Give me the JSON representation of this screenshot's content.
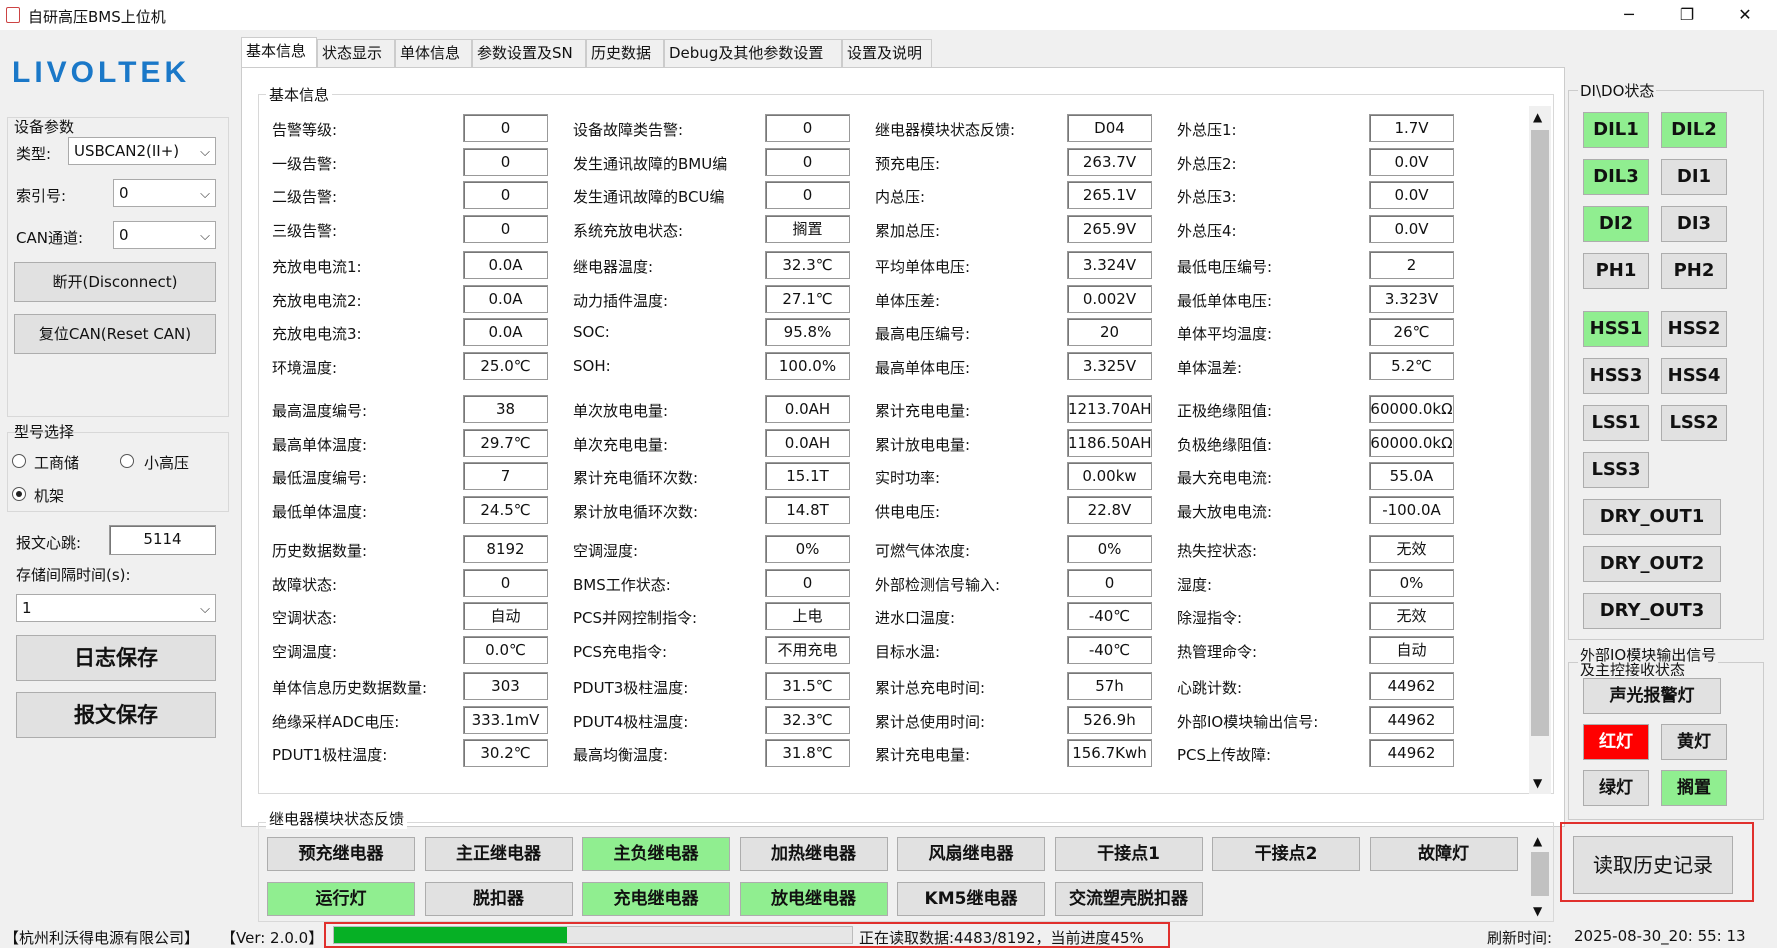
{
  "window": {
    "title": "自研高压BMS上位机",
    "min": "─",
    "max": "❐",
    "close": "✕"
  },
  "logo": "LIVOLTEK",
  "device": {
    "group_title": "设备参数",
    "type_label": "类型:",
    "type_value": "USBCAN2(II+)",
    "index_label": "索引号:",
    "index_value": "0",
    "channel_label": "CAN通道:",
    "channel_value": "0",
    "disconnect": "断开(Disconnect)",
    "reset": "复位CAN(Reset CAN)"
  },
  "model": {
    "group_title": "型号选择",
    "opt1": "工商储",
    "opt2": "小高压",
    "opt3": "机架",
    "selected": "机架"
  },
  "heartbeat_label": "报文心跳:",
  "heartbeat_value": "5114",
  "interval_label": "存储间隔时间(s):",
  "interval_value": "1",
  "log_save": "日志保存",
  "msg_save": "报文保存",
  "tabs": [
    "基本信息",
    "状态显示",
    "单体信息",
    "参数设置及SN",
    "历史数据",
    "Debug及其他参数设置",
    "设置及说明"
  ],
  "basic": {
    "group_title": "基本信息",
    "rows": [
      [
        [
          "告警等级:",
          "0"
        ],
        [
          "设备故障类告警:",
          "0"
        ],
        [
          "继电器模块状态反馈:",
          "D04"
        ],
        [
          "外总压1:",
          "1.7V"
        ]
      ],
      [
        [
          "一级告警:",
          "0"
        ],
        [
          "发生通讯故障的BMU编",
          "0"
        ],
        [
          "预充电压:",
          "263.7V"
        ],
        [
          "外总压2:",
          "0.0V"
        ]
      ],
      [
        [
          "二级告警:",
          "0"
        ],
        [
          "发生通讯故障的BCU编",
          "0"
        ],
        [
          "内总压:",
          "265.1V"
        ],
        [
          "外总压3:",
          "0.0V"
        ]
      ],
      [
        [
          "三级告警:",
          "0"
        ],
        [
          "系统充放电状态:",
          "搁置"
        ],
        [
          "累加总压:",
          "265.9V"
        ],
        [
          "外总压4:",
          "0.0V"
        ]
      ],
      [
        [
          "充放电电流1:",
          "0.0A"
        ],
        [
          "继电器温度:",
          "32.3℃"
        ],
        [
          "平均单体电压:",
          "3.324V"
        ],
        [
          "最低电压编号:",
          "2"
        ]
      ],
      [
        [
          "充放电电流2:",
          "0.0A"
        ],
        [
          "动力插件温度:",
          "27.1℃"
        ],
        [
          "单体压差:",
          "0.002V"
        ],
        [
          "最低单体电压:",
          "3.323V"
        ]
      ],
      [
        [
          "充放电电流3:",
          "0.0A"
        ],
        [
          "SOC:",
          "95.8%"
        ],
        [
          "最高电压编号:",
          "20"
        ],
        [
          "单体平均温度:",
          "26℃"
        ]
      ],
      [
        [
          "环境温度:",
          "25.0℃"
        ],
        [
          "SOH:",
          "100.0%"
        ],
        [
          "最高单体电压:",
          "3.325V"
        ],
        [
          "单体温差:",
          "5.2℃"
        ]
      ],
      [
        [
          "最高温度编号:",
          "38"
        ],
        [
          "单次放电电量:",
          "0.0AH"
        ],
        [
          "累计充电电量:",
          "1213.70AH"
        ],
        [
          "正极绝缘阻值:",
          "60000.0kΩ"
        ]
      ],
      [
        [
          "最高单体温度:",
          "29.7℃"
        ],
        [
          "单次充电电量:",
          "0.0AH"
        ],
        [
          "累计放电电量:",
          "1186.50AH"
        ],
        [
          "负极绝缘阻值:",
          "60000.0kΩ"
        ]
      ],
      [
        [
          "最低温度编号:",
          "7"
        ],
        [
          "累计充电循环次数:",
          "15.1T"
        ],
        [
          "实时功率:",
          "0.00kw"
        ],
        [
          "最大充电电流:",
          "55.0A"
        ]
      ],
      [
        [
          "最低单体温度:",
          "24.5℃"
        ],
        [
          "累计放电循环次数:",
          "14.8T"
        ],
        [
          "供电电压:",
          "22.8V"
        ],
        [
          "最大放电电流:",
          "-100.0A"
        ]
      ],
      [
        [
          "历史数据数量:",
          "8192"
        ],
        [
          "空调湿度:",
          "0%"
        ],
        [
          "可燃气体浓度:",
          "0%"
        ],
        [
          "热失控状态:",
          "无效"
        ]
      ],
      [
        [
          "故障状态:",
          "0"
        ],
        [
          "BMS工作状态:",
          "0"
        ],
        [
          "外部检测信号输入:",
          "0"
        ],
        [
          "湿度:",
          "0%"
        ]
      ],
      [
        [
          "空调状态:",
          "自动"
        ],
        [
          "PCS并网控制指令:",
          "上电"
        ],
        [
          "进水口温度:",
          "-40℃"
        ],
        [
          "除湿指令:",
          "无效"
        ]
      ],
      [
        [
          "空调温度:",
          "0.0℃"
        ],
        [
          "PCS充电指令:",
          "不用充电"
        ],
        [
          "目标水温:",
          "-40℃"
        ],
        [
          "热管理命令:",
          "自动"
        ]
      ],
      [
        [
          "单体信息历史数据数量:",
          "303"
        ],
        [
          "PDUT3极柱温度:",
          "31.5℃"
        ],
        [
          "累计总充电时间:",
          "57h"
        ],
        [
          "心跳计数:",
          "44962"
        ]
      ],
      [
        [
          "绝缘采样ADC电压:",
          "333.1mV"
        ],
        [
          "PDUT4极柱温度:",
          "32.3℃"
        ],
        [
          "累计总使用时间:",
          "526.9h"
        ],
        [
          "外部IO模块输出信号:",
          "44962"
        ]
      ],
      [
        [
          "PDUT1极柱温度:",
          "30.2℃"
        ],
        [
          "最高均衡温度:",
          "31.8℃"
        ],
        [
          "累计充电电量:",
          "156.7Kwh"
        ],
        [
          "PCS上传故障:",
          "44962"
        ]
      ]
    ]
  },
  "relay": {
    "group_title": "继电器模块状态反馈",
    "items": [
      {
        "label": "预充继电器",
        "on": false
      },
      {
        "label": "主正继电器",
        "on": false
      },
      {
        "label": "主负继电器",
        "on": true
      },
      {
        "label": "加热继电器",
        "on": false
      },
      {
        "label": "风扇继电器",
        "on": false
      },
      {
        "label": "干接点1",
        "on": false
      },
      {
        "label": "干接点2",
        "on": false
      },
      {
        "label": "故障灯",
        "on": false
      },
      {
        "label": "运行灯",
        "on": true
      },
      {
        "label": "脱扣器",
        "on": false
      },
      {
        "label": "充电继电器",
        "on": true
      },
      {
        "label": "放电继电器",
        "on": true
      },
      {
        "label": "KM5继电器",
        "on": false
      },
      {
        "label": "交流塑壳脱扣器",
        "on": false
      }
    ]
  },
  "dido": {
    "group_title": "DI\\DO状态",
    "pairs": [
      [
        {
          "label": "DIL1",
          "on": true
        },
        {
          "label": "DIL2",
          "on": true
        }
      ],
      [
        {
          "label": "DIL3",
          "on": true
        },
        {
          "label": "DI1",
          "on": false
        }
      ],
      [
        {
          "label": "DI2",
          "on": true
        },
        {
          "label": "DI3",
          "on": false
        }
      ],
      [
        {
          "label": "PH1",
          "on": false
        },
        {
          "label": "PH2",
          "on": false
        }
      ],
      [
        {
          "label": "HSS1",
          "on": true
        },
        {
          "label": "HSS2",
          "on": false
        }
      ],
      [
        {
          "label": "HSS3",
          "on": false
        },
        {
          "label": "HSS4",
          "on": false
        }
      ],
      [
        {
          "label": "LSS1",
          "on": false
        },
        {
          "label": "LSS2",
          "on": false
        }
      ],
      [
        {
          "label": "LSS3",
          "on": false
        }
      ]
    ],
    "dry": [
      "DRY_OUT1",
      "DRY_OUT2",
      "DRY_OUT3"
    ]
  },
  "io": {
    "group_title": "外部IO模块输出信号",
    "group_title_2": "及主控接收状态",
    "alarm": "声光报警灯",
    "red": "红灯",
    "yellow": "黄灯",
    "green": "绿灯",
    "idle": "搁置"
  },
  "read_history": "读取历史记录",
  "status": {
    "company": "【杭州利沃得电源有限公司】",
    "version": "【Ver: 2.0.0】",
    "progress": 0.45,
    "progress_text": "正在读取数据:4483/8192，当前进度45%",
    "refresh_label": "刷新时间:",
    "refresh_time": "2025-08-30_20: 55: 13"
  },
  "colors": {
    "on": "#90ee90",
    "red": "#ff0000",
    "progress": "#06b025",
    "logo": "#1a78c8",
    "highlight_border": "#e0302d"
  },
  "icons": {
    "scroll_up": "▲",
    "scroll_down": "▼",
    "dropdown": "⌵"
  }
}
